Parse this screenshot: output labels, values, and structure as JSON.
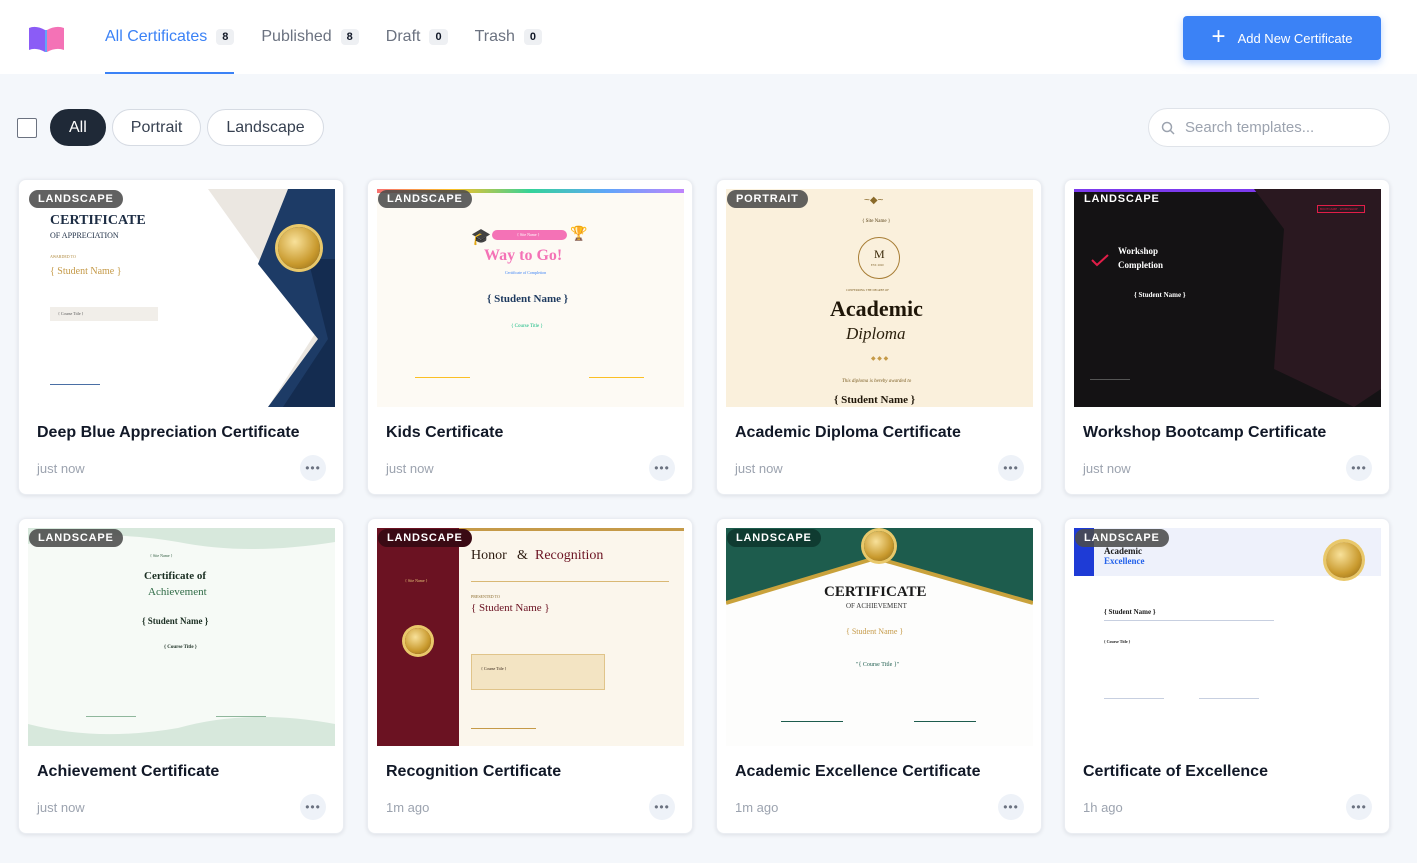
{
  "header": {
    "tabs": [
      {
        "label": "All Certificates",
        "count": "8"
      },
      {
        "label": "Published",
        "count": "8"
      },
      {
        "label": "Draft",
        "count": "0"
      },
      {
        "label": "Trash",
        "count": "0"
      }
    ],
    "add_button_label": "Add New Certificate"
  },
  "filters": {
    "options": [
      "All",
      "Portrait",
      "Landscape"
    ],
    "selected": "All",
    "search_placeholder": "Search templates..."
  },
  "cards": [
    {
      "badge": "LANDSCAPE",
      "title": "Deep Blue Appreciation Certificate",
      "time": "just now"
    },
    {
      "badge": "LANDSCAPE",
      "title": "Kids Certificate",
      "time": "just now"
    },
    {
      "badge": "PORTRAIT",
      "title": "Academic Diploma Certificate",
      "time": "just now"
    },
    {
      "badge": "LANDSCAPE",
      "title": "Workshop Bootcamp Certificate",
      "time": "just now"
    },
    {
      "badge": "LANDSCAPE",
      "title": "Achievement Certificate",
      "time": "just now"
    },
    {
      "badge": "LANDSCAPE",
      "title": "Recognition Certificate",
      "time": "1m ago"
    },
    {
      "badge": "LANDSCAPE",
      "title": "Academic Excellence Certificate",
      "time": "1m ago"
    },
    {
      "badge": "LANDSCAPE",
      "title": "Certificate of Excellence",
      "time": "1h ago"
    }
  ],
  "previews": {
    "deep_blue": {
      "title": "CERTIFICATE",
      "subtitle": "OF APPRECIATION",
      "awarded": "AWARDED TO",
      "name": "{ Student Name }",
      "course": "{ Course Title }"
    },
    "kids": {
      "site": "{ Site Name }",
      "title": "Way to Go!",
      "subtitle": "Certificate of Completion",
      "name": "{ Student Name }",
      "course": "{ Course Title }"
    },
    "diploma": {
      "site": "{ Site Name }",
      "monogram": "M",
      "est": "EST. 2020",
      "degree": "CONFERRING THE DEGREE OF",
      "title": "Academic",
      "subtitle": "Diploma",
      "awarded": "This diploma is hereby awarded to",
      "name": "{ Student Name }"
    },
    "workshop": {
      "title_line1": "Workshop",
      "title_line2": "Completion",
      "name": "{ Student Name }",
      "tag": "BOOTCAMP · WORKSHOP"
    },
    "achievement": {
      "site": "{ Site Name }",
      "title_line1": "Certificate of",
      "title_line2": "Achievement",
      "name": "{ Student Name }",
      "course": "{ Course Title }"
    },
    "recognition": {
      "site": "{ Site Name }",
      "title_a": "Honor",
      "title_b": "Recognition",
      "presented": "PRESENTED TO",
      "name": "{ Student Name }",
      "course": "{ Course Title }"
    },
    "excellence": {
      "title": "CERTIFICATE",
      "subtitle": "OF ACHIEVEMENT",
      "name": "{ Student Name }",
      "course": "\"{ Course Title }\""
    },
    "cert_excellence": {
      "title_line1": "Academic",
      "title_line2": "Excellence",
      "name": "{ Student Name }",
      "course": "{ Course Title }"
    }
  },
  "colors": {
    "accent": "#3b82f6",
    "dark_pill": "#1f2937"
  }
}
